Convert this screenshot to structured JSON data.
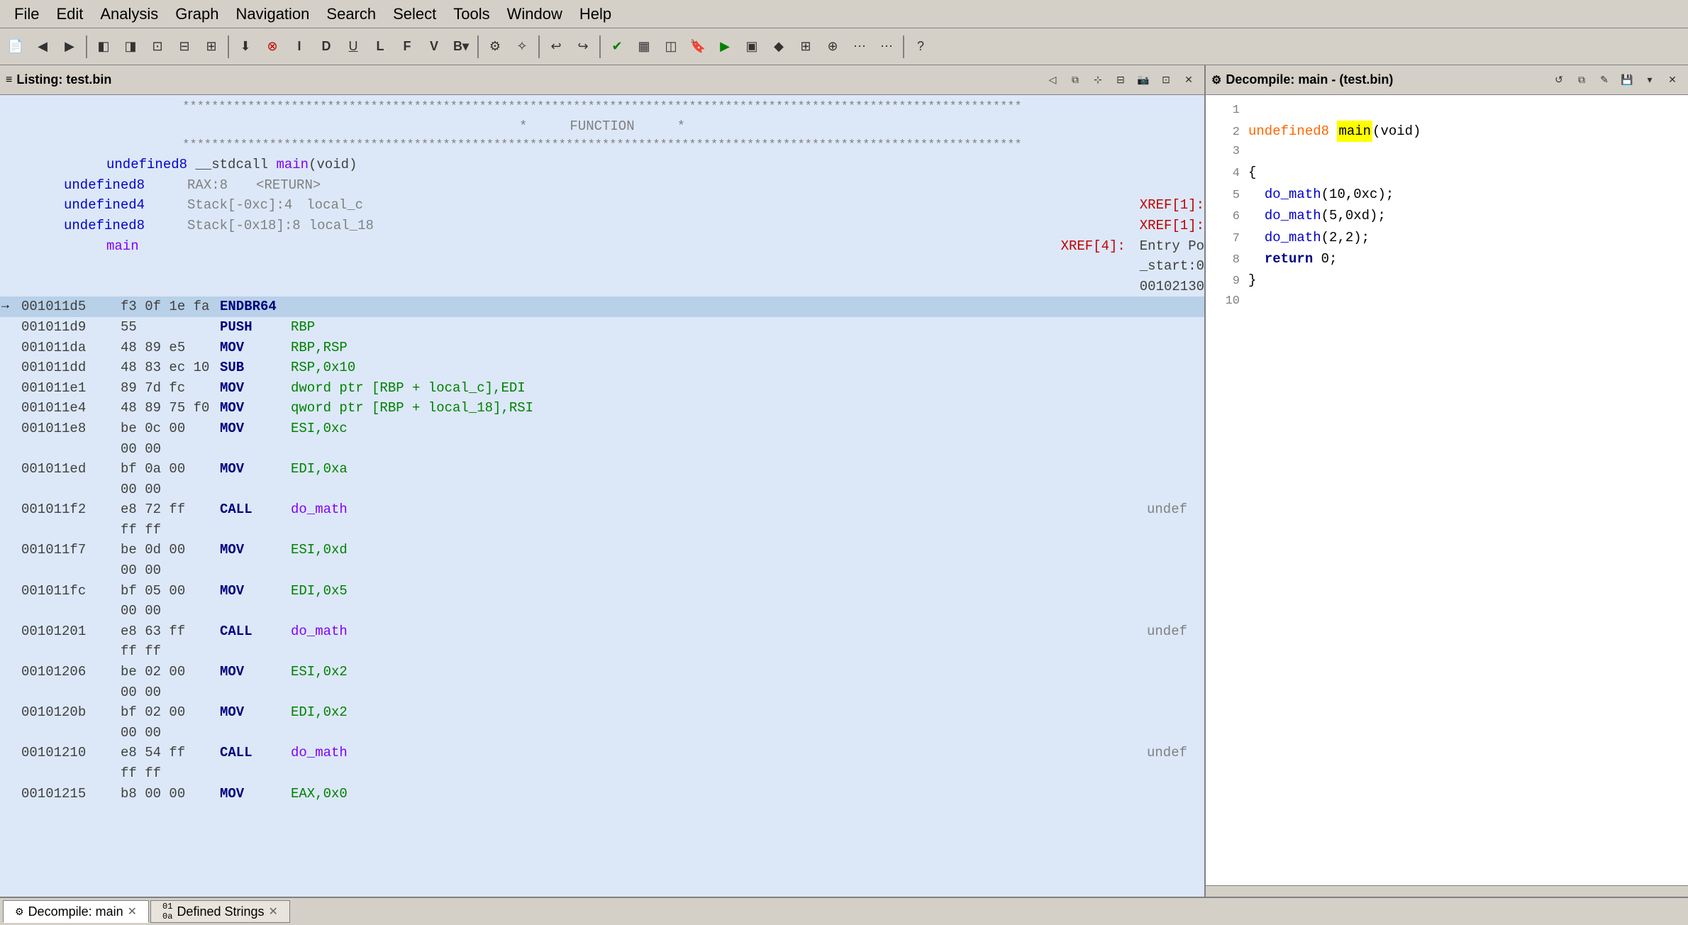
{
  "menubar": {
    "items": [
      "File",
      "Edit",
      "Analysis",
      "Graph",
      "Navigation",
      "Search",
      "Select",
      "Tools",
      "Window",
      "Help"
    ]
  },
  "listing_panel": {
    "title": "Listing:  test.bin",
    "icon": "≡"
  },
  "decompile_panel": {
    "title": "Decompile: main -  (test.bin)",
    "icon": "⚙"
  },
  "listing": {
    "lines": [
      {
        "type": "stars",
        "text": "************************************************************"
      },
      {
        "type": "function_label",
        "text": "FUNCTION"
      },
      {
        "type": "stars",
        "text": "************************************************************"
      },
      {
        "type": "func_def",
        "text": "undefined8  __stdcall  main(void)"
      },
      {
        "type": "var",
        "kw": "undefined8",
        "label": "RAX:8",
        "name": "<RETURN>"
      },
      {
        "type": "var",
        "kw": "undefined4",
        "label": "Stack[-0xc]:4",
        "name": "local_c",
        "xref": "XREF[1]:"
      },
      {
        "type": "var",
        "kw": "undefined8",
        "label": "Stack[-0x18]:8",
        "name": "local_18",
        "xref": "XREF[1]:"
      },
      {
        "type": "main_label",
        "text": "main",
        "xref": "XREF[4]:",
        "refs": [
          "Entry Po",
          "_start:0",
          "00102130"
        ]
      },
      {
        "addr": "001011d5",
        "bytes": "f3 0f 1e fa",
        "mnem": "ENDBR64",
        "operands": "",
        "is_current": true
      },
      {
        "addr": "001011d9",
        "bytes": "55",
        "mnem": "PUSH",
        "operands": "RBP"
      },
      {
        "addr": "001011da",
        "bytes": "48 89 e5",
        "mnem": "MOV",
        "operands": "RBP,RSP"
      },
      {
        "addr": "001011dd",
        "bytes": "48 83 ec 10",
        "mnem": "SUB",
        "operands": "RSP,0x10"
      },
      {
        "addr": "001011e1",
        "bytes": "89 7d fc",
        "mnem": "MOV",
        "operands": "dword ptr [RBP + local_c],EDI"
      },
      {
        "addr": "001011e4",
        "bytes": "48 89 75 f0",
        "mnem": "MOV",
        "operands": "qword ptr [RBP + local_18],RSI"
      },
      {
        "addr": "001011e8",
        "bytes": "be 0c 00",
        "mnem": "MOV",
        "operands": "ESI,0xc"
      },
      {
        "addr": "",
        "bytes": "00 00",
        "mnem": "",
        "operands": ""
      },
      {
        "addr": "001011ed",
        "bytes": "bf 0a 00",
        "mnem": "MOV",
        "operands": "EDI,0xa"
      },
      {
        "addr": "",
        "bytes": "00 00",
        "mnem": "",
        "operands": ""
      },
      {
        "addr": "001011f2",
        "bytes": "e8 72 ff",
        "mnem": "CALL",
        "operands": "do_math",
        "comment": "undef",
        "is_call": true
      },
      {
        "addr": "",
        "bytes": "ff ff",
        "mnem": "",
        "operands": ""
      },
      {
        "addr": "001011f7",
        "bytes": "be 0d 00",
        "mnem": "MOV",
        "operands": "ESI,0xd"
      },
      {
        "addr": "",
        "bytes": "00 00",
        "mnem": "",
        "operands": ""
      },
      {
        "addr": "001011fc",
        "bytes": "bf 05 00",
        "mnem": "MOV",
        "operands": "EDI,0x5"
      },
      {
        "addr": "",
        "bytes": "00 00",
        "mnem": "",
        "operands": ""
      },
      {
        "addr": "00101201",
        "bytes": "e8 63 ff",
        "mnem": "CALL",
        "operands": "do_math",
        "comment": "undef",
        "is_call": true
      },
      {
        "addr": "",
        "bytes": "ff ff",
        "mnem": "",
        "operands": ""
      },
      {
        "addr": "00101206",
        "bytes": "be 02 00",
        "mnem": "MOV",
        "operands": "ESI,0x2"
      },
      {
        "addr": "",
        "bytes": "00 00",
        "mnem": "",
        "operands": ""
      },
      {
        "addr": "0010120b",
        "bytes": "bf 02 00",
        "mnem": "MOV",
        "operands": "EDI,0x2"
      },
      {
        "addr": "",
        "bytes": "00 00",
        "mnem": "",
        "operands": ""
      },
      {
        "addr": "00101210",
        "bytes": "e8 54 ff",
        "mnem": "CALL",
        "operands": "do_math",
        "comment": "undef",
        "is_call": true
      },
      {
        "addr": "",
        "bytes": "ff ff",
        "mnem": "",
        "operands": ""
      },
      {
        "addr": "00101215",
        "bytes": "b8 00 00",
        "mnem": "MOV",
        "operands": "EAX,0x0"
      }
    ]
  },
  "decompile": {
    "lines": [
      {
        "num": 1,
        "text": ""
      },
      {
        "num": 2,
        "text": "undefined8 main(void)",
        "has_highlight": true
      },
      {
        "num": 3,
        "text": ""
      },
      {
        "num": 4,
        "text": "{"
      },
      {
        "num": 5,
        "text": "  do_math(10,0xc);"
      },
      {
        "num": 6,
        "text": "  do_math(5,0xd);"
      },
      {
        "num": 7,
        "text": "  do_math(2,2);"
      },
      {
        "num": 8,
        "text": "  return 0;"
      },
      {
        "num": 9,
        "text": "}"
      },
      {
        "num": 10,
        "text": ""
      }
    ]
  },
  "bottom_tabs": [
    {
      "label": "Decompile: main",
      "icon": "⚙",
      "active": true
    },
    {
      "label": "Defined Strings",
      "icon": "≡",
      "active": false
    }
  ],
  "colors": {
    "bg_listing": "#dce8f8",
    "bg_decompile": "#ffffff",
    "bg_toolbar": "#d4d0c8",
    "highlight_yellow": "#ffff00",
    "text_blue": "#0000cc",
    "text_green": "#008000",
    "text_purple": "#8000ff",
    "text_red": "#c00000",
    "text_gray": "#808080",
    "current_line": "#b8d0e8"
  }
}
